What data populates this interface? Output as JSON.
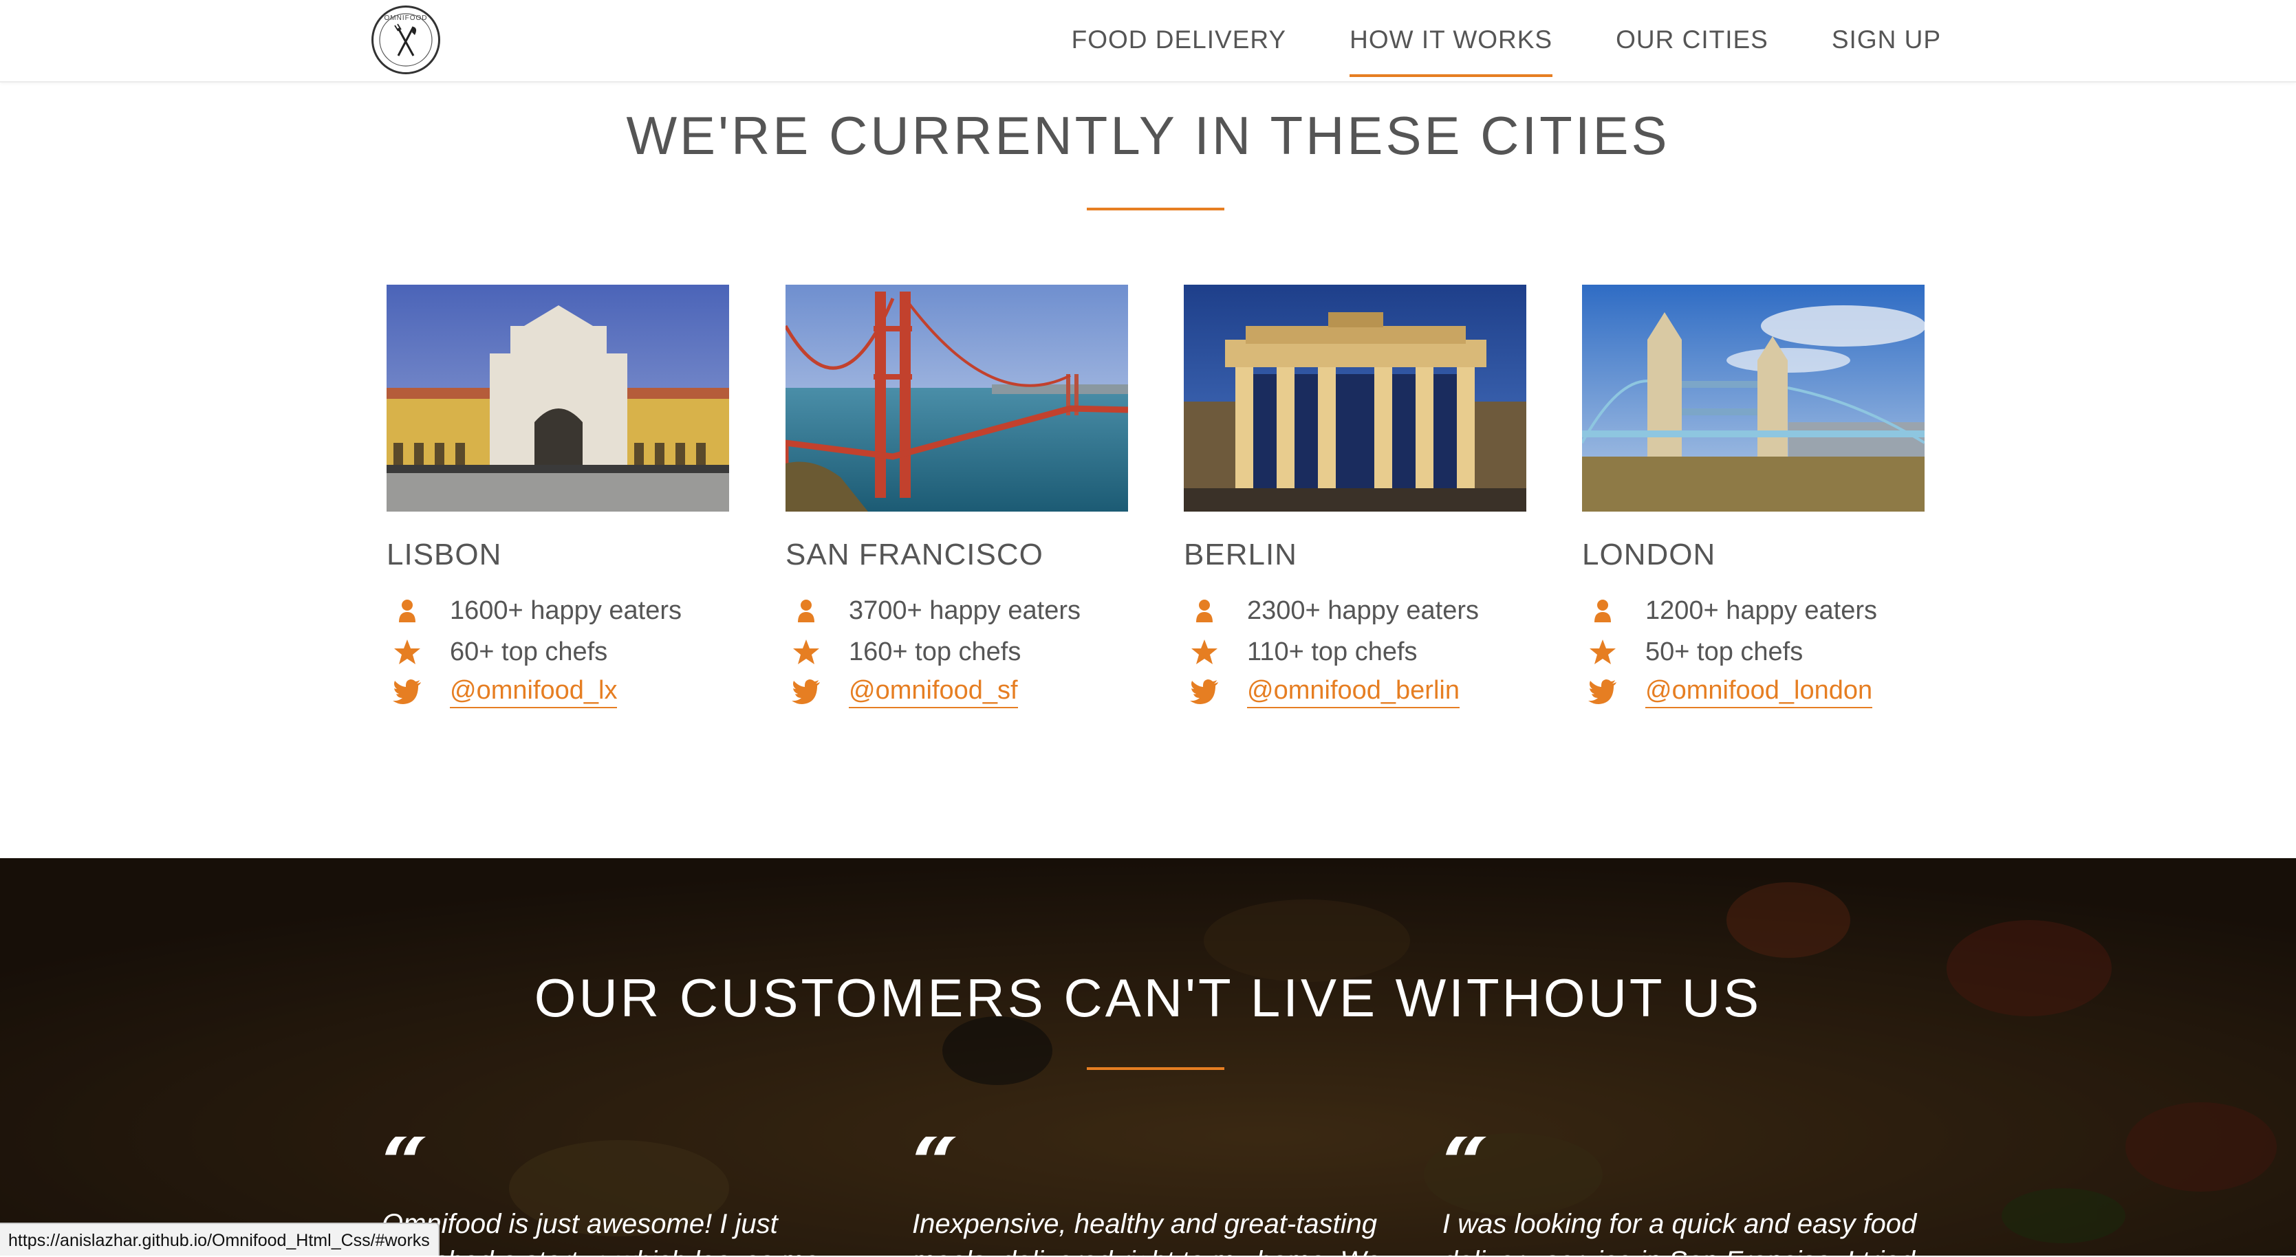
{
  "header": {
    "logo_text": "OMNIFOOD",
    "nav": [
      {
        "label": "FOOD DELIVERY",
        "active": false
      },
      {
        "label": "HOW IT WORKS",
        "active": true
      },
      {
        "label": "OUR CITIES",
        "active": false
      },
      {
        "label": "SIGN UP",
        "active": false
      }
    ]
  },
  "cities_section": {
    "title": "WE'RE CURRENTLY IN THESE CITIES",
    "cities": [
      {
        "name": "LISBON",
        "eaters": "1600+ happy eaters",
        "chefs": "60+ top chefs",
        "twitter": "@omnifood_lx"
      },
      {
        "name": "SAN FRANCISCO",
        "eaters": "3700+ happy eaters",
        "chefs": "160+ top chefs",
        "twitter": "@omnifood_sf"
      },
      {
        "name": "BERLIN",
        "eaters": "2300+ happy eaters",
        "chefs": "110+ top chefs",
        "twitter": "@omnifood_berlin"
      },
      {
        "name": "LONDON",
        "eaters": "1200+ happy eaters",
        "chefs": "50+ top chefs",
        "twitter": "@omnifood_london"
      }
    ]
  },
  "testimonials_section": {
    "title": "OUR CUSTOMERS CAN'T LIVE WITHOUT US",
    "quote_mark": "“",
    "quotes": [
      {
        "text": "Omnifood is just awesome! I just launched a startup which leaves me"
      },
      {
        "text": "Inexpensive, healthy and great-tasting meals, delivered right to my home. We"
      },
      {
        "text": "I was looking for a quick and easy food delivery service in San Franciso. I tried"
      }
    ]
  },
  "status_bar": {
    "url": "https://anislazhar.github.io/Omnifood_Html_Css/#works"
  },
  "colors": {
    "accent": "#e67e22",
    "text": "#555555",
    "testimonials_overlay": "#1c140c"
  },
  "icons": {
    "eaters": "person-icon",
    "chefs": "star-icon",
    "twitter": "twitter-icon"
  }
}
